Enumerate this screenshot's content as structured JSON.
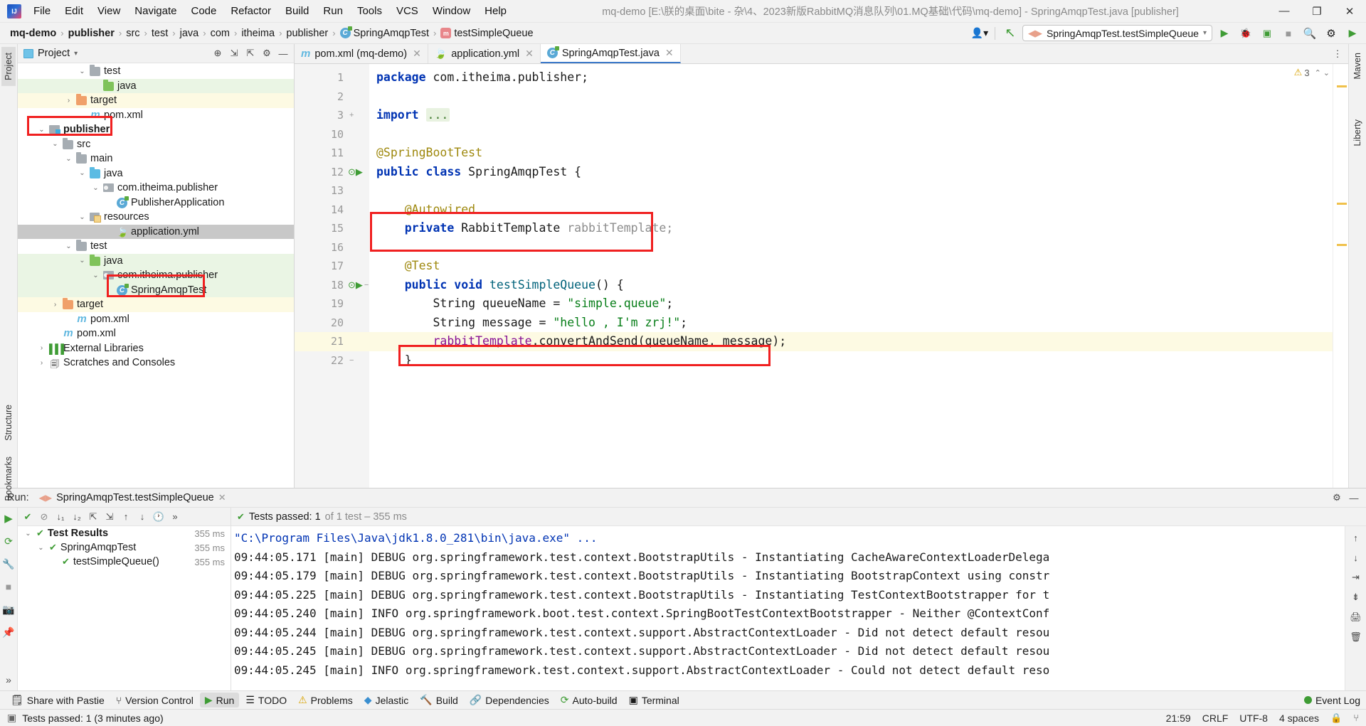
{
  "window": {
    "title": "mq-demo [E:\\朕的桌面\\bite - 杂\\4、2023新版RabbitMQ消息队列\\01.MQ基础\\代码\\mq-demo] - SpringAmqpTest.java [publisher]",
    "minimize": "—",
    "maximize": "❐",
    "close": "✕"
  },
  "menubar": [
    {
      "label": "File"
    },
    {
      "label": "Edit"
    },
    {
      "label": "View"
    },
    {
      "label": "Navigate"
    },
    {
      "label": "Code"
    },
    {
      "label": "Refactor"
    },
    {
      "label": "Build"
    },
    {
      "label": "Run"
    },
    {
      "label": "Tools"
    },
    {
      "label": "VCS"
    },
    {
      "label": "Window"
    },
    {
      "label": "Help"
    }
  ],
  "breadcrumb": {
    "items": [
      {
        "label": "mq-demo",
        "bold": true,
        "icon": ""
      },
      {
        "label": "publisher",
        "bold": true,
        "icon": ""
      },
      {
        "label": "src",
        "bold": false,
        "icon": ""
      },
      {
        "label": "test",
        "bold": false,
        "icon": ""
      },
      {
        "label": "java",
        "bold": false,
        "icon": ""
      },
      {
        "label": "com",
        "bold": false,
        "icon": ""
      },
      {
        "label": "itheima",
        "bold": false,
        "icon": ""
      },
      {
        "label": "publisher",
        "bold": false,
        "icon": ""
      },
      {
        "label": "SpringAmqpTest",
        "bold": false,
        "icon": "class-icon"
      },
      {
        "label": "testSimpleQueue",
        "bold": false,
        "icon": "method-icon"
      }
    ],
    "separator": "›"
  },
  "toolbar_right": {
    "run_configuration": "SpringAmqpTest.testSimpleQueue",
    "run_label": "▶",
    "debug_label": "🐞",
    "coverage_label": "▣",
    "stop_label": "■",
    "search_label": "🔍",
    "settings_label": "⚙",
    "updates_label": "▶"
  },
  "left_strip": {
    "project_tab": "Project",
    "structure_tab": "Structure",
    "bookmarks_tab": "Bookmarks",
    "expand_label": "»"
  },
  "right_strip": {
    "maven_tab": "Maven",
    "liberty_tab": "Liberty"
  },
  "project_panel": {
    "title": "Project",
    "dropdown": "▾",
    "icons": [
      "locate-icon",
      "collapse-all-icon",
      "expand-all-icon",
      "settings-icon",
      "hide-icon"
    ],
    "tree": [
      {
        "label": "test",
        "indent": 4,
        "arrow": "v",
        "icon": "folder-grey",
        "row": "plain",
        "bold": false
      },
      {
        "label": "java",
        "indent": 5,
        "arrow": "",
        "icon": "folder-green",
        "row": "green",
        "bold": false
      },
      {
        "label": "target",
        "indent": 3,
        "arrow": ">",
        "icon": "folder-orange",
        "row": "yellow",
        "bold": false
      },
      {
        "label": "pom.xml",
        "indent": 4,
        "arrow": "",
        "icon": "maven-icon",
        "row": "plain",
        "bold": false
      },
      {
        "label": "publisher",
        "indent": 1,
        "arrow": "v",
        "icon": "module-icon",
        "row": "plain",
        "bold": true
      },
      {
        "label": "src",
        "indent": 2,
        "arrow": "v",
        "icon": "folder-grey",
        "row": "plain",
        "bold": false
      },
      {
        "label": "main",
        "indent": 3,
        "arrow": "v",
        "icon": "folder-grey",
        "row": "plain",
        "bold": false
      },
      {
        "label": "java",
        "indent": 4,
        "arrow": "v",
        "icon": "folder-blue",
        "row": "plain",
        "bold": false
      },
      {
        "label": "com.itheima.publisher",
        "indent": 5,
        "arrow": "v",
        "icon": "package-icon",
        "row": "plain",
        "bold": false
      },
      {
        "label": "PublisherApplication",
        "indent": 6,
        "arrow": "",
        "icon": "class-icon",
        "row": "plain",
        "bold": false
      },
      {
        "label": "resources",
        "indent": 4,
        "arrow": "v",
        "icon": "resources-icon",
        "row": "plain",
        "bold": false
      },
      {
        "label": "application.yml",
        "indent": 6,
        "arrow": "",
        "icon": "yml-icon",
        "row": "sel",
        "bold": false
      },
      {
        "label": "test",
        "indent": 3,
        "arrow": "v",
        "icon": "folder-grey",
        "row": "plain",
        "bold": false
      },
      {
        "label": "java",
        "indent": 4,
        "arrow": "v",
        "icon": "folder-green",
        "row": "green",
        "bold": false
      },
      {
        "label": "com.itheima.publisher",
        "indent": 5,
        "arrow": "v",
        "icon": "package-icon",
        "row": "green",
        "bold": false
      },
      {
        "label": "SpringAmqpTest",
        "indent": 6,
        "arrow": "",
        "icon": "class-icon",
        "row": "green",
        "bold": false
      },
      {
        "label": "target",
        "indent": 2,
        "arrow": ">",
        "icon": "folder-orange",
        "row": "yellow",
        "bold": false
      },
      {
        "label": "pom.xml",
        "indent": 3,
        "arrow": "",
        "icon": "maven-icon",
        "row": "plain",
        "bold": false
      },
      {
        "label": "pom.xml",
        "indent": 2,
        "arrow": "",
        "icon": "maven-icon",
        "row": "plain",
        "bold": false
      },
      {
        "label": "External Libraries",
        "indent": 1,
        "arrow": ">",
        "icon": "library-icon",
        "row": "plain",
        "bold": false
      },
      {
        "label": "Scratches and Consoles",
        "indent": 1,
        "arrow": ">",
        "icon": "scratches-icon",
        "row": "plain",
        "bold": false
      }
    ]
  },
  "editor": {
    "tabs": [
      {
        "label": "pom.xml (mq-demo)",
        "icon": "maven-icon",
        "active": false,
        "close": "✕"
      },
      {
        "label": "application.yml",
        "icon": "yml-icon",
        "active": false,
        "close": "✕"
      },
      {
        "label": "SpringAmqpTest.java",
        "icon": "class-icon",
        "active": true,
        "close": "✕"
      }
    ],
    "warning_count": "3",
    "warning_icon": "⚠",
    "inspection_up": "⌃",
    "inspection_down": "⌄",
    "lines": [
      {
        "num": "1",
        "run": false,
        "fold": "",
        "hl": false,
        "tokens": [
          {
            "t": "package ",
            "c": "kw"
          },
          {
            "t": "com.itheima.publisher;",
            "c": "plain"
          }
        ]
      },
      {
        "num": "2",
        "run": false,
        "fold": "",
        "hl": false,
        "tokens": []
      },
      {
        "num": "3",
        "run": false,
        "fold": "+",
        "hl": false,
        "tokens": [
          {
            "t": "import ",
            "c": "kw"
          },
          {
            "t": "...",
            "c": "fold"
          }
        ]
      },
      {
        "num": "10",
        "run": false,
        "fold": "",
        "hl": false,
        "tokens": []
      },
      {
        "num": "11",
        "run": false,
        "fold": "",
        "hl": false,
        "tokens": [
          {
            "t": "@SpringBootTest",
            "c": "ann"
          }
        ]
      },
      {
        "num": "12",
        "run": true,
        "fold": "",
        "hl": false,
        "tokens": [
          {
            "t": "public class ",
            "c": "kw"
          },
          {
            "t": "SpringAmqpTest {",
            "c": "plain"
          }
        ]
      },
      {
        "num": "13",
        "run": false,
        "fold": "",
        "hl": false,
        "tokens": []
      },
      {
        "num": "14",
        "run": false,
        "fold": "",
        "hl": false,
        "tokens": [
          {
            "t": "    @Autowired",
            "c": "ann"
          }
        ]
      },
      {
        "num": "15",
        "run": false,
        "fold": "",
        "hl": false,
        "tokens": [
          {
            "t": "    private ",
            "c": "kw"
          },
          {
            "t": "RabbitTemplate ",
            "c": "plain"
          },
          {
            "t": "rabbitTemplate;",
            "c": "grey"
          }
        ]
      },
      {
        "num": "16",
        "run": false,
        "fold": "",
        "hl": false,
        "tokens": []
      },
      {
        "num": "17",
        "run": false,
        "fold": "",
        "hl": false,
        "tokens": [
          {
            "t": "    @Test",
            "c": "ann"
          }
        ]
      },
      {
        "num": "18",
        "run": true,
        "fold": "−",
        "hl": false,
        "tokens": [
          {
            "t": "    public void ",
            "c": "kw"
          },
          {
            "t": "testSimpleQueue",
            "c": "mth"
          },
          {
            "t": "() {",
            "c": "plain"
          }
        ]
      },
      {
        "num": "19",
        "run": false,
        "fold": "",
        "hl": false,
        "tokens": [
          {
            "t": "        String queueName = ",
            "c": "plain"
          },
          {
            "t": "\"simple.queue\"",
            "c": "str"
          },
          {
            "t": ";",
            "c": "plain"
          }
        ]
      },
      {
        "num": "20",
        "run": false,
        "fold": "",
        "hl": false,
        "tokens": [
          {
            "t": "        String message = ",
            "c": "plain"
          },
          {
            "t": "\"hello , I'm zrj!\"",
            "c": "str"
          },
          {
            "t": ";",
            "c": "plain"
          }
        ]
      },
      {
        "num": "21",
        "run": false,
        "fold": "",
        "hl": true,
        "tokens": [
          {
            "t": "        ",
            "c": "plain"
          },
          {
            "t": "rabbitTemplate",
            "c": "fld"
          },
          {
            "t": ".convertAndSend(queueName, message);",
            "c": "plain"
          }
        ]
      },
      {
        "num": "22",
        "run": false,
        "fold": "−",
        "hl": false,
        "tokens": [
          {
            "t": "    }",
            "c": "plain"
          }
        ]
      }
    ]
  },
  "run_panel": {
    "label": "Run:",
    "tab_title": "SpringAmqpTest.testSimpleQueue",
    "tab_close": "✕",
    "settings_icon": "⚙",
    "hide_icon": "—",
    "toolbar_icons": [
      "rerun-icon",
      "rerun-failed-icon",
      "stop-icon",
      "pin-icon"
    ],
    "tests_toolbar_icons": [
      "show-passed-icon",
      "ignore-icon",
      "sort-alpha-icon",
      "sort-duration-icon",
      "expand-icon",
      "collapse-icon",
      "history-icon",
      "more-icon"
    ],
    "status": {
      "icon": "✔",
      "text": "Tests passed: 1",
      "detail": "of 1 test – 355 ms"
    },
    "tests": [
      {
        "label": "Test Results",
        "ms": "355 ms",
        "indent": 0,
        "arrow": "v",
        "bold": true
      },
      {
        "label": "SpringAmqpTest",
        "ms": "355 ms",
        "indent": 1,
        "arrow": "v",
        "bold": false
      },
      {
        "label": "testSimpleQueue()",
        "ms": "355 ms",
        "indent": 2,
        "arrow": "",
        "bold": false
      }
    ],
    "console": [
      {
        "text": "\"C:\\Program Files\\Java\\jdk1.8.0_281\\bin\\java.exe\" ...",
        "cmd": true
      },
      {
        "text": "09:44:05.171 [main] DEBUG org.springframework.test.context.BootstrapUtils - Instantiating CacheAwareContextLoaderDelega",
        "cmd": false
      },
      {
        "text": "09:44:05.179 [main] DEBUG org.springframework.test.context.BootstrapUtils - Instantiating BootstrapContext using constr",
        "cmd": false
      },
      {
        "text": "09:44:05.225 [main] DEBUG org.springframework.test.context.BootstrapUtils - Instantiating TestContextBootstrapper for t",
        "cmd": false
      },
      {
        "text": "09:44:05.240 [main] INFO org.springframework.boot.test.context.SpringBootTestContextBootstrapper - Neither @ContextConf",
        "cmd": false
      },
      {
        "text": "09:44:05.244 [main] DEBUG org.springframework.test.context.support.AbstractContextLoader - Did not detect default resou",
        "cmd": false
      },
      {
        "text": "09:44:05.245 [main] DEBUG org.springframework.test.context.support.AbstractContextLoader - Did not detect default resou",
        "cmd": false
      },
      {
        "text": "09:44:05.245 [main] INFO org.springframework.test.context.support.AbstractContextLoader - Could not detect default reso",
        "cmd": false
      }
    ],
    "console_right_icons": [
      "soft-wrap-icon",
      "scroll-end-icon",
      "print-icon",
      "clear-all-icon"
    ]
  },
  "bottom_bar": {
    "items": [
      {
        "label": "Share with Pastie",
        "icon": "pastie-icon",
        "active": false
      },
      {
        "label": "Version Control",
        "icon": "branch-icon",
        "active": false
      },
      {
        "label": "Run",
        "icon": "run-icon",
        "active": true
      },
      {
        "label": "TODO",
        "icon": "todo-icon",
        "active": false
      },
      {
        "label": "Problems",
        "icon": "problems-icon",
        "active": false
      },
      {
        "label": "Jelastic",
        "icon": "jelastic-icon",
        "active": false
      },
      {
        "label": "Build",
        "icon": "build-icon",
        "active": false
      },
      {
        "label": "Dependencies",
        "icon": "dependencies-icon",
        "active": false
      },
      {
        "label": "Auto-build",
        "icon": "autobuild-icon",
        "active": false
      },
      {
        "label": "Terminal",
        "icon": "terminal-icon",
        "active": false
      }
    ],
    "event_log": "Event Log"
  },
  "status_bar": {
    "message": "Tests passed: 1 (3 minutes ago)",
    "position": "21:59",
    "line_sep": "CRLF",
    "encoding": "UTF-8",
    "indent": "4 spaces",
    "lock_icon": "🔒",
    "branch_icon": "⑂"
  }
}
